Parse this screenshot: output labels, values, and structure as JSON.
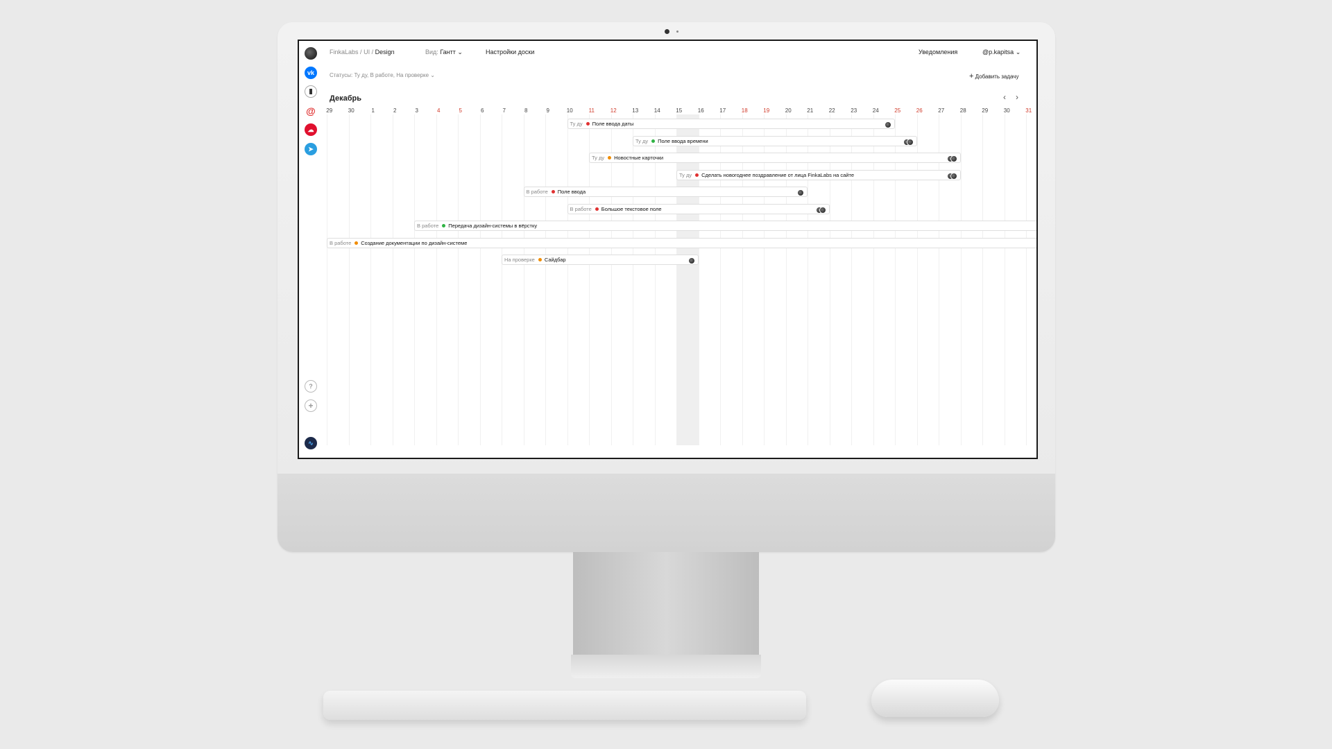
{
  "app": {
    "breadcrumb": [
      "FinkaLabs",
      "/",
      "UI",
      "/",
      "Design"
    ],
    "view_label": "Вид:",
    "view_value": "Гантт",
    "board_settings": "Настройки доски",
    "notifications": "Уведомления",
    "user": "@p.kapitsa",
    "statuses_filter": "Статусы: Ту ду, В работе, На проверке",
    "add_task": "Добавить задачу",
    "month": "Декабрь"
  },
  "sidebar": {
    "icons": [
      "avatar-icon",
      "vk-icon",
      "bookmark-icon",
      "mail-at-icon",
      "cloud-icon",
      "telegram-icon",
      "help-icon",
      "add-icon",
      "profile-icon"
    ]
  },
  "timeline": {
    "days": [
      "29",
      "30",
      "1",
      "2",
      "3",
      "4",
      "5",
      "6",
      "7",
      "8",
      "9",
      "10",
      "11",
      "12",
      "13",
      "14",
      "15",
      "16",
      "17",
      "18",
      "19",
      "20",
      "21",
      "22",
      "23",
      "24",
      "25",
      "26",
      "27",
      "28",
      "29",
      "30",
      "31"
    ],
    "weekend_days": [
      "4",
      "5",
      "11",
      "12",
      "18",
      "19",
      "25",
      "26",
      "31"
    ],
    "today": "15"
  },
  "tasks": [
    {
      "status": "Ту ду",
      "title": "Поле ввода даты",
      "dot": "#e03131",
      "start": "10",
      "end": "24",
      "avatars": 1
    },
    {
      "status": "Ту ду",
      "title": "Поле ввода времени",
      "dot": "#2fb344",
      "start": "13",
      "end": "25",
      "avatars": 2
    },
    {
      "status": "Ту ду",
      "title": "Новостные карточки",
      "dot": "#f08c00",
      "start": "11",
      "end": "27",
      "avatars": 2
    },
    {
      "status": "Ту ду",
      "title": "Сделать новогоднее поздравление от лица FinkaLabs на сайте",
      "dot": "#e03131",
      "start": "15",
      "end": "27",
      "avatars": 2
    },
    {
      "status": "В работе",
      "title": "Поле ввода",
      "dot": "#e03131",
      "start": "8",
      "end": "20",
      "avatars": 1
    },
    {
      "status": "В работе",
      "title": "Большое текстовое поле",
      "dot": "#e03131",
      "start": "10",
      "end": "21",
      "avatars": 2
    },
    {
      "status": "В работе",
      "title": "Передача дизайн-системы в вёрстку",
      "dot": "#2fb344",
      "start": "3",
      "end": "31+",
      "avatars": 0
    },
    {
      "status": "В работе",
      "title": "Создание документации по дизайн-системе",
      "dot": "#f08c00",
      "start": "29",
      "end": "31+",
      "avatars": 0
    },
    {
      "status": "На проверке",
      "title": "Сайдбар",
      "dot": "#f08c00",
      "start": "7",
      "end": "15",
      "avatars": 1
    }
  ]
}
